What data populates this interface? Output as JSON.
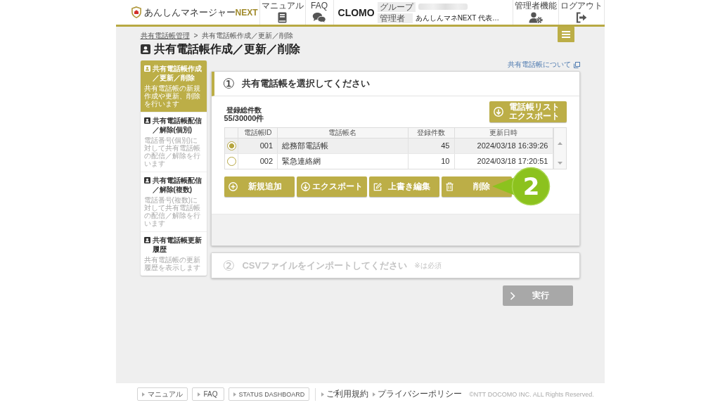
{
  "header": {
    "logo": "あんしんマネージャー**NEXT**",
    "nav": [
      {
        "label": "マニュアル",
        "kind": "manual"
      },
      {
        "label": "FAQ",
        "kind": "faq"
      }
    ],
    "brand": "CLOMO",
    "account": [
      {
        "label": "グループ",
        "kind": "blurred"
      },
      {
        "label": "管理者",
        "value": "あんしんマネNEXT 代表…",
        "kind": "text"
      }
    ],
    "actions": [
      {
        "label": "管理者機能",
        "kind": "admin"
      },
      {
        "label": "ログアウト",
        "kind": "logout"
      }
    ]
  },
  "breadcrumb": {
    "items": [
      {
        "label": "共有電話帳管理",
        "kind": "link"
      },
      {
        "label": "共有電話帳作成／更新／削除",
        "kind": "current"
      }
    ],
    "separator": ">"
  },
  "page_title": "共有電話帳作成／更新／削除",
  "sidebar": {
    "items": [
      {
        "title": "共有電話帳作成／更新／削除",
        "description": "共有電話帳の新規作成や更新、削除を行います",
        "selected": true
      },
      {
        "title": "共有電話帳配信／解除(個別)",
        "description": "電話番号(個別)に対して共有電話帳の配信／解除を行います",
        "selected": false
      },
      {
        "title": "共有電話帳配信／解除(複数)",
        "description": "電話番号(複数)に対して共有電話帳の配信／解除を行います",
        "selected": false
      },
      {
        "title": "共有電話帳更新履歴",
        "description": "共有電話帳の更新履歴を表示します",
        "selected": false
      }
    ]
  },
  "help_link": "共有電話帳について",
  "steps": [
    {
      "number": "①",
      "title": "共有電話帳を選択してください",
      "disabled": false,
      "count_label": "登録総件数",
      "count_value": "55/30000件",
      "export_button": [
        "電話帳リスト",
        "エクスポート"
      ],
      "table": {
        "columns": [
          "電話帳ID",
          "電話帳名",
          "登録件数",
          "更新日時"
        ],
        "rows": [
          {
            "selected": true,
            "id": "001",
            "name": "総務部電話帳",
            "count": "45",
            "updated": "2024/03/18 16:39:26"
          },
          {
            "selected": false,
            "id": "002",
            "name": "緊急連絡網",
            "count": "10",
            "updated": "2024/03/18 17:20:51"
          }
        ]
      },
      "actions": [
        {
          "label": "新規追加",
          "kind": "add"
        },
        {
          "label": "エクスポート",
          "kind": "export"
        },
        {
          "label": "上書き編集",
          "kind": "edit"
        },
        {
          "label": "削除",
          "kind": "delete"
        }
      ],
      "callout": "2"
    },
    {
      "number": "②",
      "title": "CSVファイルをインポートしてください",
      "note": "※は必須",
      "disabled": true
    }
  ],
  "execute_button": {
    "label": "実行",
    "disabled": true
  },
  "footer": {
    "buttons": [
      "マニュアル",
      "FAQ",
      "STATUS DASHBOARD"
    ],
    "links": [
      "ご利用規約",
      "プライバシーポリシー"
    ],
    "copyright": "©NTT DOCOMO INC. ALL Rights Reserved."
  }
}
